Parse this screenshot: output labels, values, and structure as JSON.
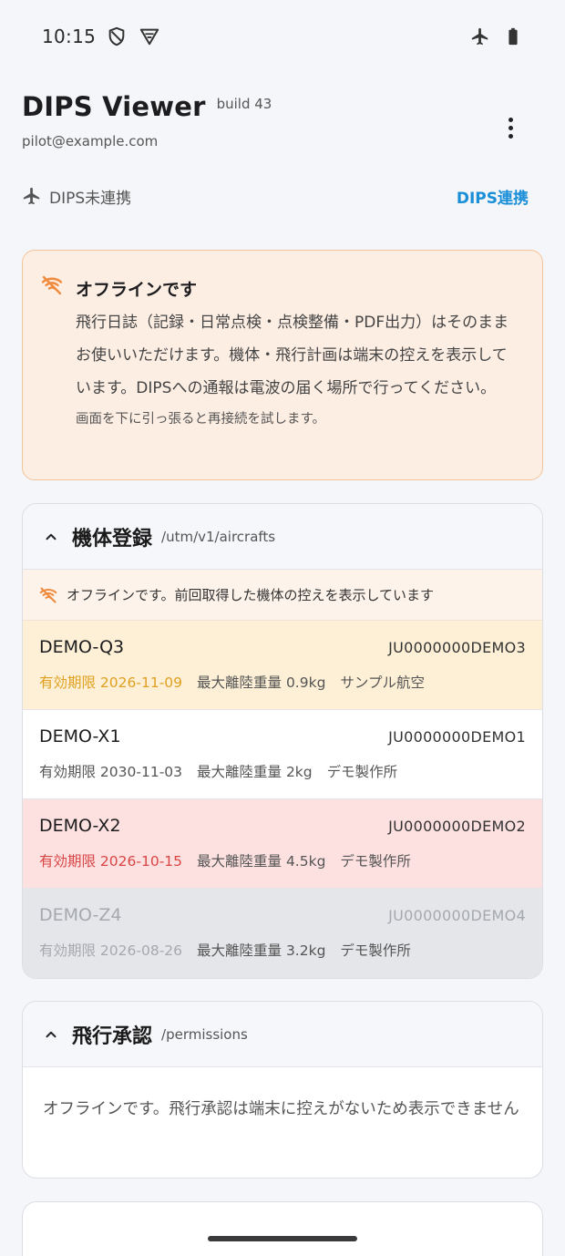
{
  "status_bar": {
    "time": "10:15",
    "icons": [
      "shield-icon",
      "vpn-icon",
      "airplane-mode-icon",
      "battery-icon"
    ]
  },
  "header": {
    "title": "DIPS Viewer",
    "build": "build 43",
    "email": "pilot@example.com",
    "menu_icon": "more-vert-icon"
  },
  "dips": {
    "status": "DIPS未連携",
    "link_label": "DIPS連携"
  },
  "offline_banner": {
    "title": "オフラインです",
    "body": "飛行日誌（記録・日常点検・点検整備・PDF出力）はそのままお使いいただけます。機体・飛行計画は端末の控えを表示しています。DIPSへの通報は電波の届く場所で行ってください。",
    "hint": "画面を下に引っ張ると再接続を試します。",
    "icon": "wifi-off-icon",
    "accent": "#f08a3c"
  },
  "aircraft_card": {
    "title": "機体登録",
    "path": "/utm/v1/aircrafts",
    "note": "オフラインです。前回取得した機体の控えを表示しています",
    "rows": [
      {
        "name": "DEMO-Q3",
        "id": "JU0000000DEMO3",
        "expiry": "有効期限 2026-11-09",
        "mtow": "最大離陸重量 0.9kg",
        "maker": "サンプル航空",
        "state": "warn"
      },
      {
        "name": "DEMO-X1",
        "id": "JU0000000DEMO1",
        "expiry": "有効期限 2030-11-03",
        "mtow": "最大離陸重量 2kg",
        "maker": "デモ製作所",
        "state": "ok"
      },
      {
        "name": "DEMO-X2",
        "id": "JU0000000DEMO2",
        "expiry": "有効期限 2026-10-15",
        "mtow": "最大離陸重量 4.5kg",
        "maker": "デモ製作所",
        "state": "danger"
      },
      {
        "name": "DEMO-Z4",
        "id": "JU0000000DEMO4",
        "expiry": "有効期限 2026-08-26",
        "mtow": "最大離陸重量 3.2kg",
        "maker": "デモ製作所",
        "state": "expired"
      }
    ]
  },
  "permissions_card": {
    "title": "飛行承認",
    "path": "/permissions",
    "body": "オフラインです。飛行承認は端末に控えがないため表示できません"
  },
  "colors": {
    "link": "#1a8fd8",
    "warn": "#e0a020",
    "danger": "#d94545",
    "banner_bg": "#fdeee4"
  }
}
